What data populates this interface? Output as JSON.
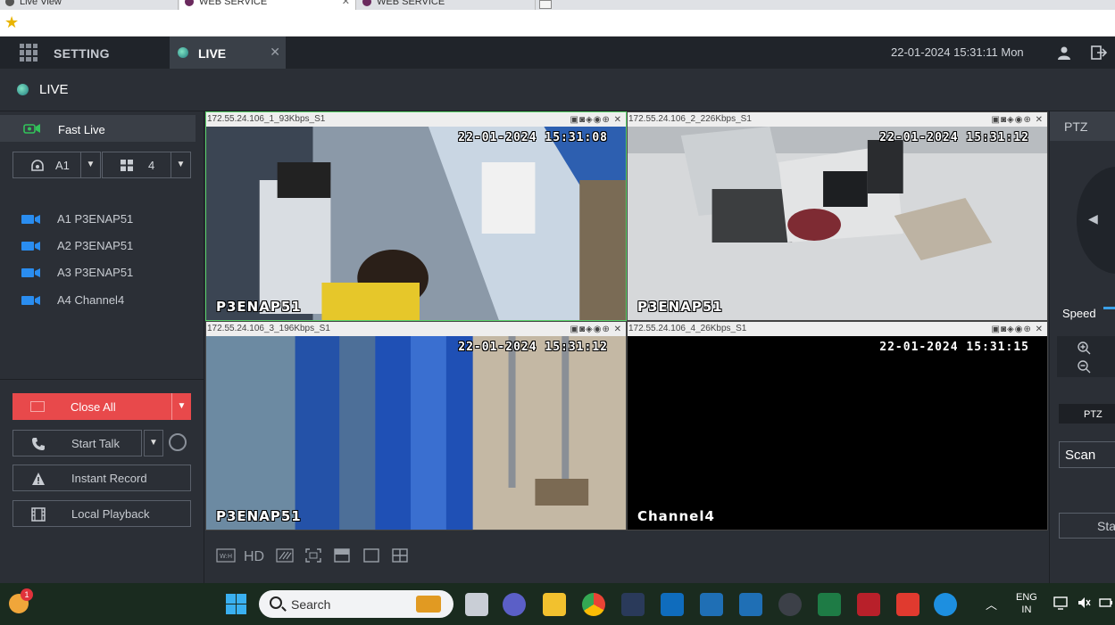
{
  "browser": {
    "tabs": [
      {
        "label": "Live View"
      },
      {
        "label": "WEB SERVICE"
      },
      {
        "label": "WEB SERVICE"
      }
    ]
  },
  "header": {
    "setting_label": "SETTING",
    "live_tab_label": "LIVE",
    "datetime": "22-01-2024 15:31:11 Mon"
  },
  "page_title": "LIVE",
  "left": {
    "fast_live": "Fast Live",
    "channel_select": "A1",
    "split_select": "4",
    "channels": [
      {
        "label": "A1 P3ENAP51"
      },
      {
        "label": "A2 P3ENAP51"
      },
      {
        "label": "A3 P3ENAP51"
      },
      {
        "label": "A4 Channel4"
      }
    ],
    "close_all": "Close All",
    "start_talk": "Start Talk",
    "instant_record": "Instant Record",
    "local_playback": "Local Playback"
  },
  "cells": [
    {
      "info": "172.55.24.106_1_93Kbps_S1",
      "timestamp": "22-01-2024 15:31:08",
      "name": "P3ENAP51"
    },
    {
      "info": "172.55.24.106_2_226Kbps_S1",
      "timestamp": "22-01-2024 15:31:12",
      "name": "P3ENAP51"
    },
    {
      "info": "172.55.24.106_3_196Kbps_S1",
      "timestamp": "22-01-2024 15:31:12",
      "name": "P3ENAP51"
    },
    {
      "info": "172.55.24.106_4_26Kbps_S1",
      "timestamp": "22-01-2024 15:31:15",
      "name": "Channel4"
    }
  ],
  "toolbar": {
    "hd_label": "HD"
  },
  "ptz": {
    "title": "PTZ",
    "speed_label": "Speed",
    "ptz_button": "PTZ",
    "scan_value": "Scan",
    "start_button": "Start"
  },
  "taskbar": {
    "search_label": "Search",
    "weather_badge": "1",
    "lang_line1": "ENG",
    "lang_line2": "IN"
  }
}
